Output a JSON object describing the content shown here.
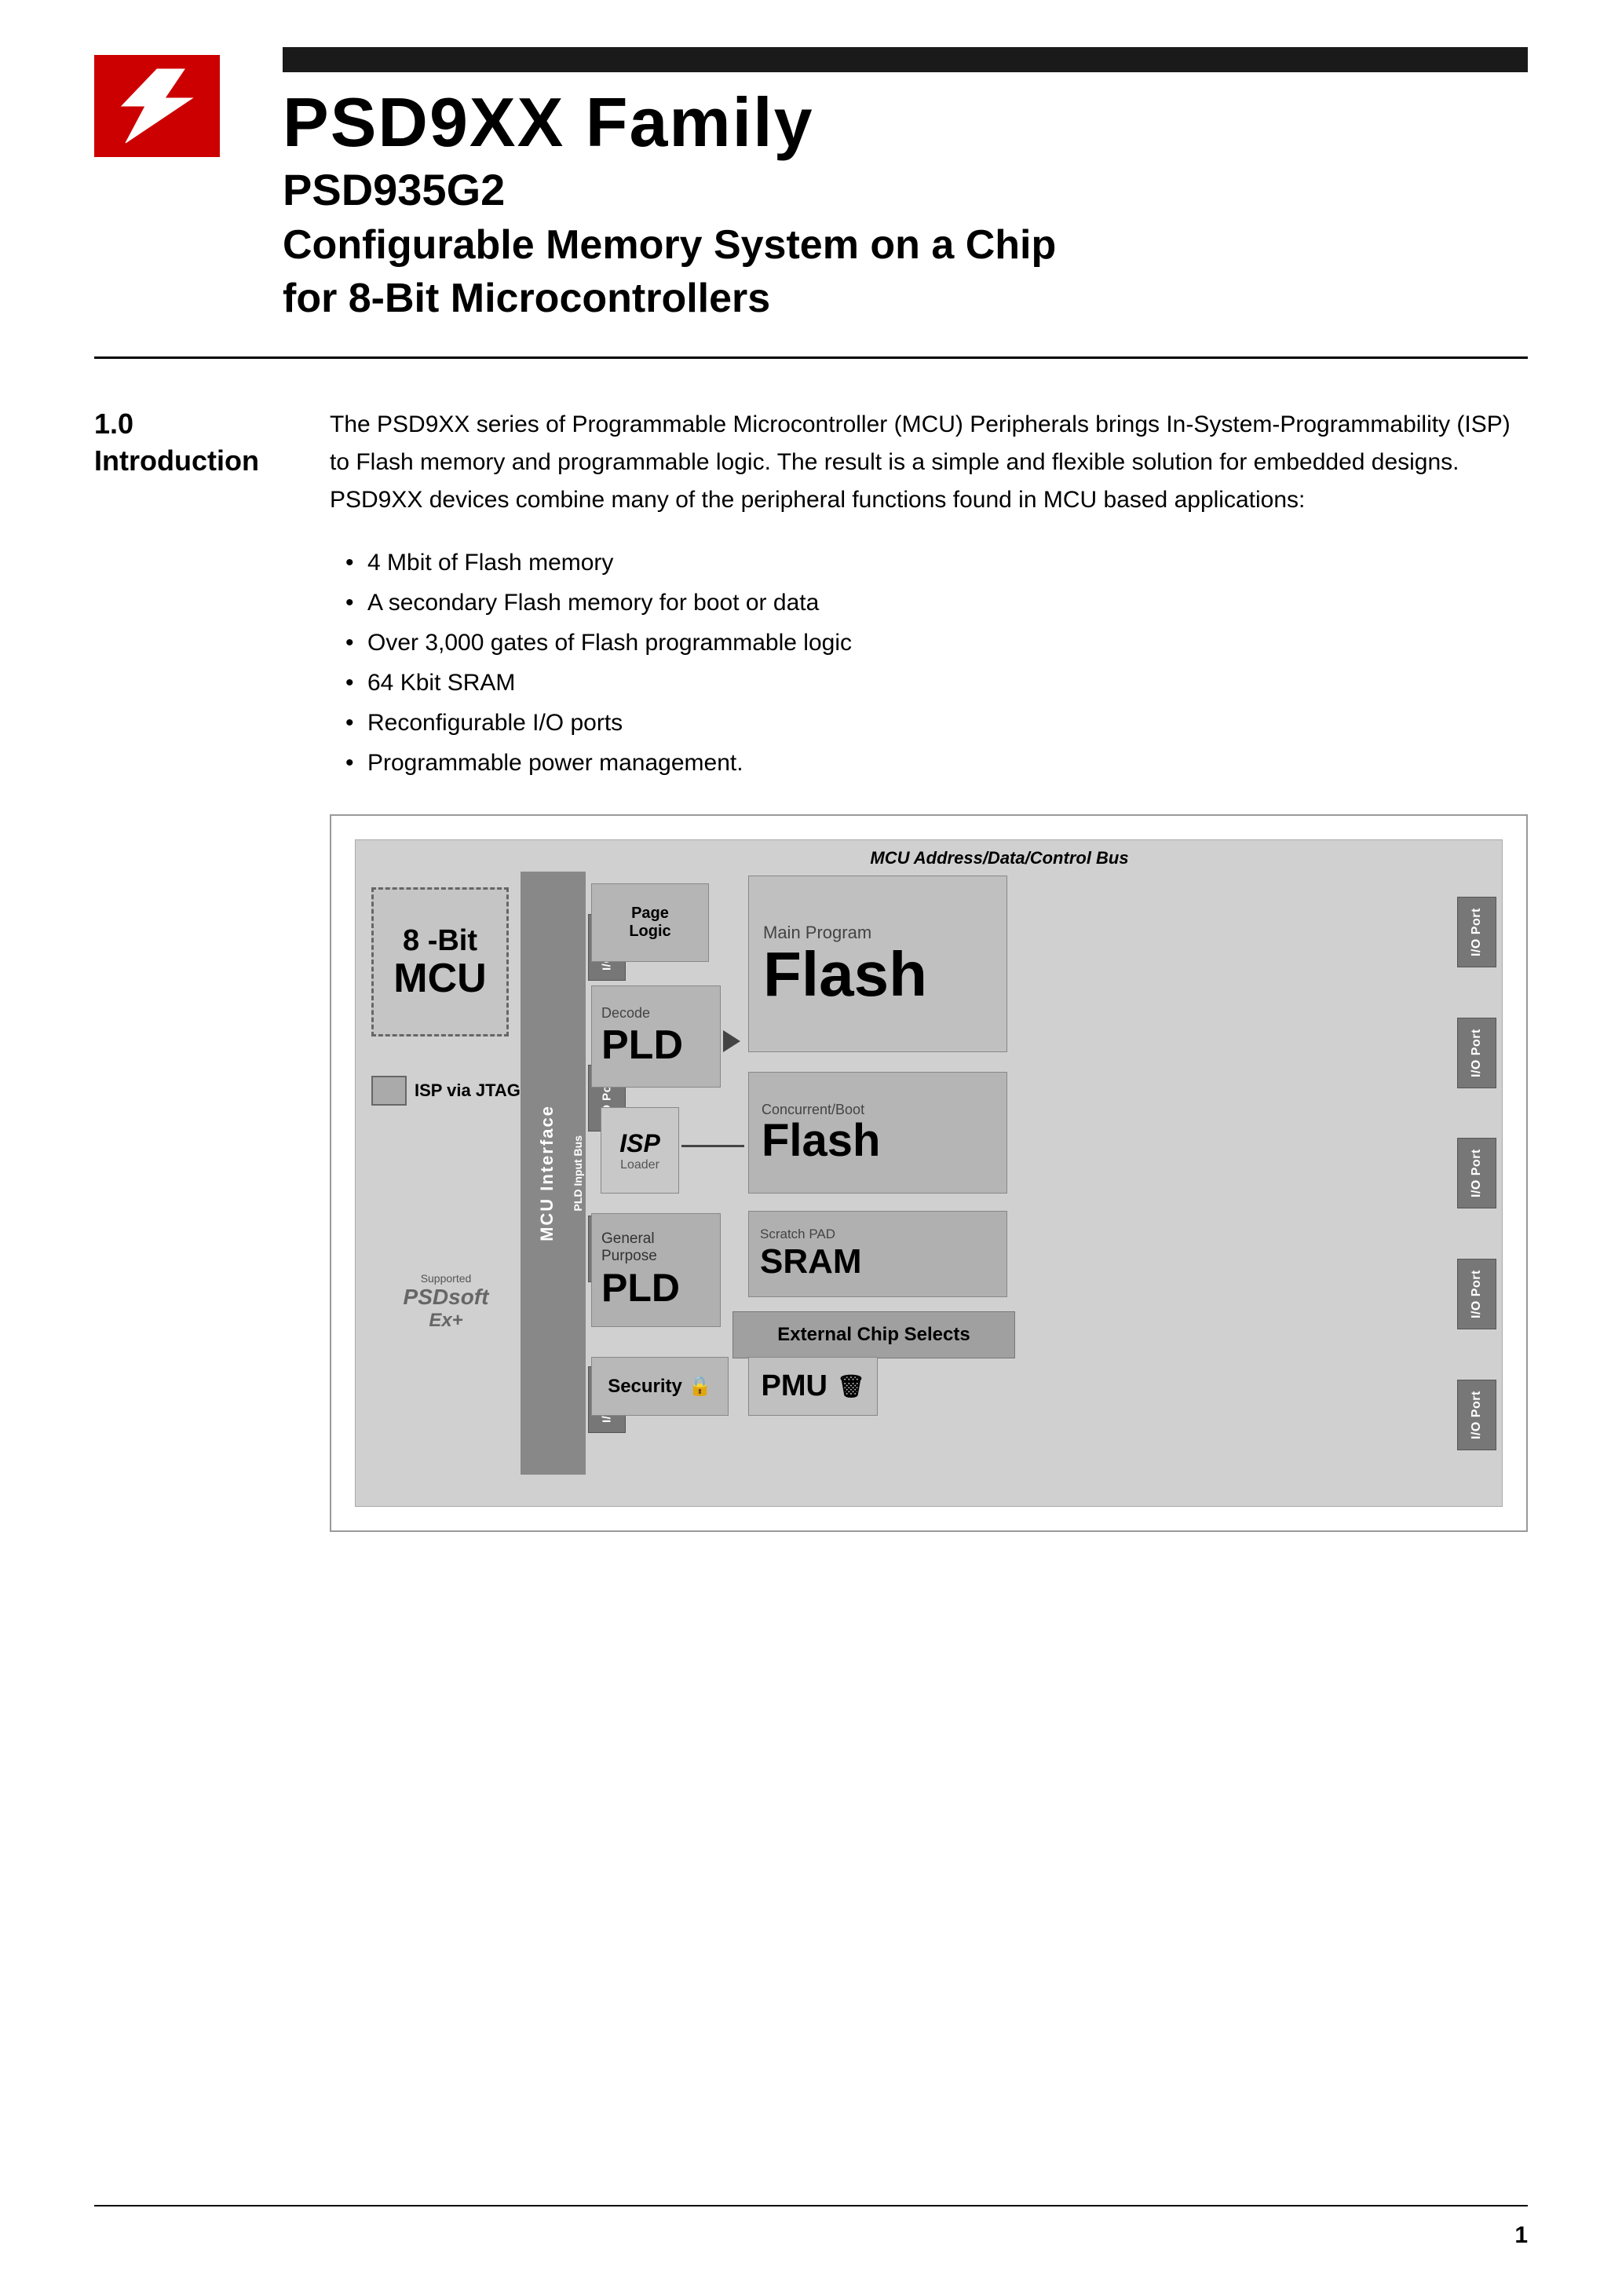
{
  "header": {
    "logo_alt": "ST Logo",
    "black_bar": "",
    "main_title": "PSD9XX Family",
    "sub_title": "PSD935G2",
    "desc_line1": "Configurable Memory System on a Chip",
    "desc_line2": "for 8-Bit Microcontrollers"
  },
  "section": {
    "number": "1.0",
    "name": "Introduction",
    "intro": "The PSD9XX series of Programmable Microcontroller (MCU) Peripherals brings In-System-Programmability (ISP) to Flash memory and programmable logic. The result is a simple and flexible solution for embedded designs. PSD9XX devices combine many of the peripheral functions found in MCU based applications:",
    "bullets": [
      "4 Mbit of Flash memory",
      "A secondary Flash memory for boot or data",
      "Over 3,000 gates of Flash programmable logic",
      "64 Kbit SRAM",
      "Reconfigurable I/O ports",
      "Programmable power management."
    ]
  },
  "diagram": {
    "bus_label": "MCU Address/Data/Control Bus",
    "mcu_label_line1": "8 -Bit",
    "mcu_label_line2": "MCU",
    "mcu_interface_label": "MCU Interface",
    "isp_via_jtag": "ISP via JTAG",
    "page_logic_line1": "Page",
    "page_logic_line2": "Logic",
    "decode_label": "Decode",
    "pld_label": "PLD",
    "isp_italic": "ISP",
    "isp_loader": "Loader",
    "general_label": "General",
    "purpose_label": "Purpose",
    "gp_pld_label": "PLD",
    "security_label": "Security",
    "pmu_label": "PMU",
    "main_program_label": "Main Program",
    "flash_big": "Flash",
    "concurrent_boot_label": "Concurrent/Boot",
    "flash_medium": "Flash",
    "scratch_pad_label": "Scratch PAD",
    "sram_label": "SRAM",
    "ext_chip_label": "External Chip Selects",
    "io_port_label": "I/O Port",
    "pld_input_bus": "PLD Input Bus",
    "supported_label": "Supported",
    "psd_logo_text": "PSDsoftwExt"
  },
  "footer": {
    "page_number": "1"
  }
}
